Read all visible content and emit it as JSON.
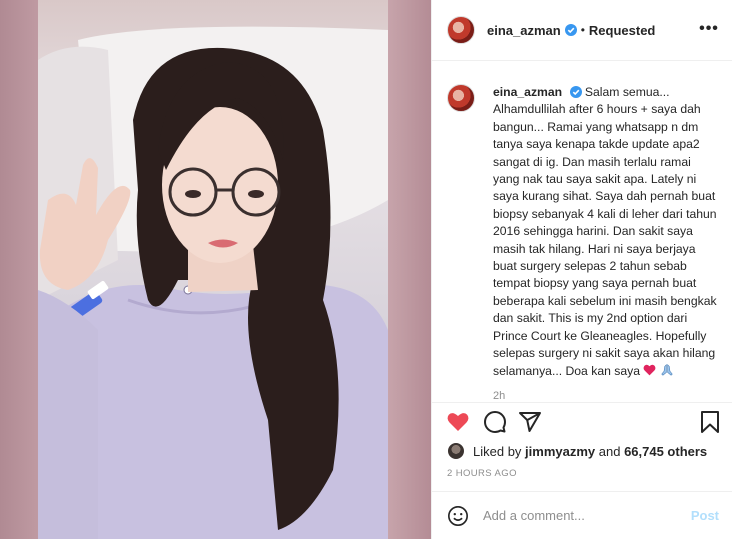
{
  "post": {
    "username": "eina_azman",
    "follow_status": "Requested",
    "more_icon": "more-horizontal-icon",
    "caption_username": "eina_azman",
    "caption": "Salam semua...\nAlhamdullilah after 6 hours + saya dah bangun... Ramai yang whatsapp n dm tanya saya kenapa takde update apa2 sangat di ig. Dan masih terlalu ramai yang nak tau saya sakit apa. Lately ni saya kurang sihat. Saya dah pernah buat biopsy sebanyak 4 kali di leher dari tahun 2016 sehingga harini. Dan sakit saya masih tak hilang. Hari ni saya berjaya buat surgery selepas 2 tahun sebab tempat biopsy yang saya pernah buat beberapa kali sebelum ini masih bengkak dan sakit. This is my 2nd option dari Prince Court ke Gleaneagles. Hopefully selepas surgery ni sakit saya akan hilang selamanya... Doa kan saya ",
    "caption_emojis": [
      "red-heart-icon",
      "praying-hands-icon"
    ],
    "caption_age": "2h",
    "likes": {
      "prefix": "Liked by ",
      "first_liker": "jimmyazmy",
      "middle": " and ",
      "others": "66,745 others"
    },
    "timestamp": "2 HOURS AGO"
  },
  "comment_box": {
    "placeholder": "Add a comment...",
    "post_label": "Post"
  },
  "colors": {
    "like_red": "#ed4956",
    "verified_blue": "#3897f0",
    "post_disabled": "#b2dffc",
    "secondary_text": "#8e8e8e"
  }
}
